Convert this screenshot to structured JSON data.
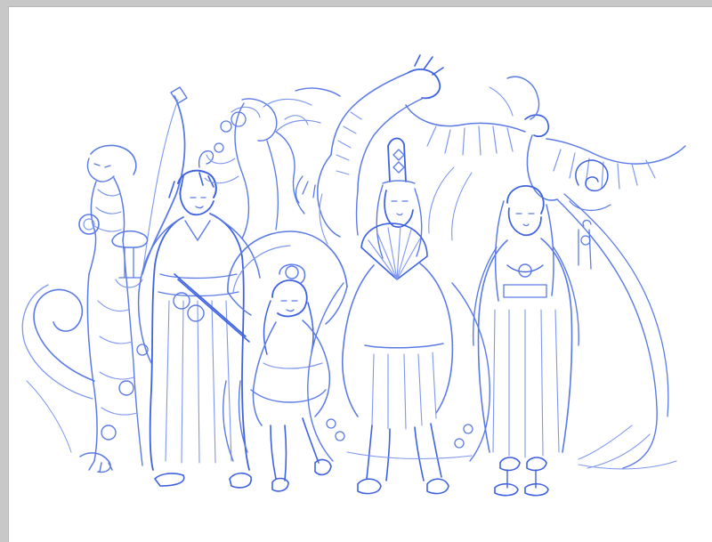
{
  "canvas": {
    "background": "#c8c8c8",
    "sheet_color": "#ffffff",
    "stroke_color": "#5b7be6",
    "content": "sketch-illustration"
  }
}
